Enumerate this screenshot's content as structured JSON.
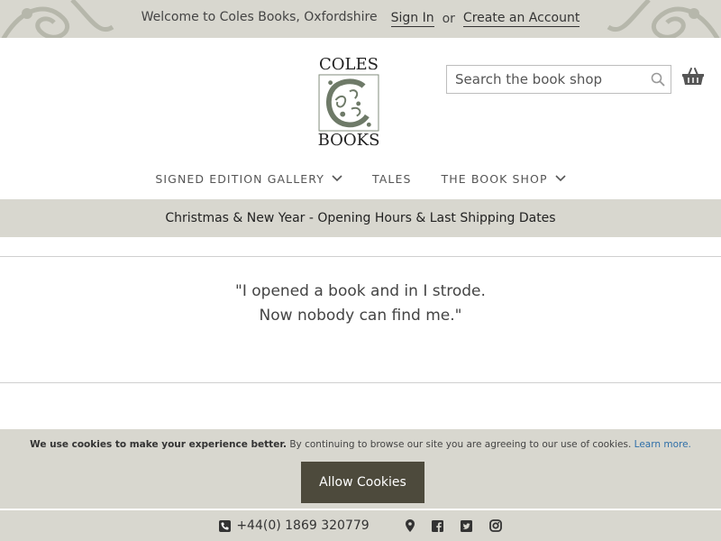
{
  "topbar": {
    "welcome": "Welcome to Coles Books, Oxfordshire",
    "sign_in": "Sign In",
    "or": "or",
    "create_account": "Create an Account"
  },
  "logo": {
    "line1": "COLES",
    "line2": "BOOKS"
  },
  "search": {
    "placeholder": "Search the book shop"
  },
  "nav": {
    "items": [
      {
        "label": "SIGNED EDITION GALLERY",
        "has_dropdown": true
      },
      {
        "label": "TALES",
        "has_dropdown": false
      },
      {
        "label": "THE BOOK SHOP",
        "has_dropdown": true
      }
    ]
  },
  "announcement": "Christmas & New Year - Opening Hours & Last Shipping Dates",
  "quote": {
    "line1": "\"I opened a book and in I strode.",
    "line2": "Now nobody can find me.\""
  },
  "cookie": {
    "bold": "We use cookies to make your experience better.",
    "text": " By continuing to browse our site you are agreeing to our use of cookies. ",
    "learn_more": "Learn more.",
    "allow_button": "Allow Cookies"
  },
  "footer": {
    "phone": "+44(0) 1869 320779",
    "icons": [
      "map-pin-icon",
      "facebook-icon",
      "twitter-icon",
      "instagram-icon"
    ]
  },
  "colors": {
    "band": "#d8d7cf",
    "button": "#4d4a3c",
    "link": "#2f6fa8"
  }
}
